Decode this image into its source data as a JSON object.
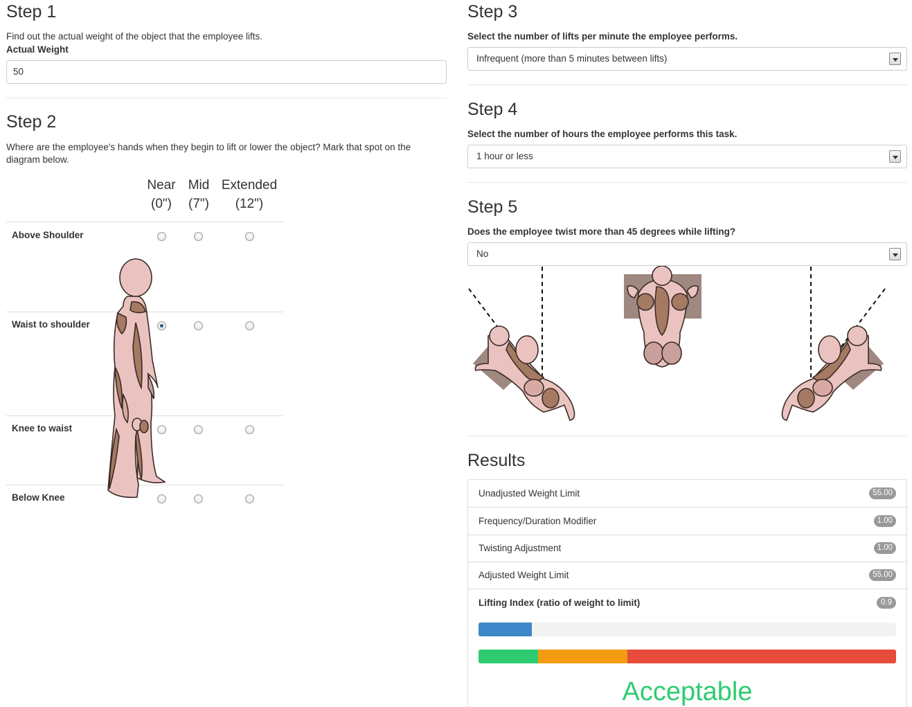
{
  "step1": {
    "title": "Step 1",
    "description": "Find out the actual weight of the object that the employee lifts.",
    "label": "Actual Weight",
    "value": "50"
  },
  "step2": {
    "title": "Step 2",
    "description_line1": "Where are the employee's hands when they begin to lift or lower the object? Mark that spot on the",
    "description_line2": "diagram below.",
    "columns": [
      {
        "name": "Near",
        "distance": "(0\")"
      },
      {
        "name": "Mid",
        "distance": "(7\")"
      },
      {
        "name": "Extended",
        "distance": "(12\")"
      }
    ],
    "rows": [
      "Above Shoulder",
      "Waist to shoulder",
      "Knee to waist",
      "Below Knee"
    ],
    "selected": {
      "row": "Waist to shoulder",
      "column": "Near"
    }
  },
  "step3": {
    "title": "Step 3",
    "label": "Select the number of lifts per minute the employee performs.",
    "selected": "Infrequent (more than 5 minutes between lifts)"
  },
  "step4": {
    "title": "Step 4",
    "label": "Select the number of hours the employee performs this task.",
    "selected": "1 hour or less"
  },
  "step5": {
    "title": "Step 5",
    "label": "Does the employee twist more than 45 degrees while lifting?",
    "selected": "No"
  },
  "results": {
    "title": "Results",
    "items": [
      {
        "label": "Unadjusted Weight Limit",
        "value": "55.00"
      },
      {
        "label": "Frequency/Duration Modifier",
        "value": "1.00"
      },
      {
        "label": "Twisting Adjustment",
        "value": "1.00"
      },
      {
        "label": "Adjusted Weight Limit",
        "value": "55.00"
      }
    ],
    "index_label": "Lifting Index (ratio of weight to limit)",
    "index_value": "0.9",
    "index_bar_fraction": 0.128,
    "scale_segments": [
      {
        "color": "#2ecc71",
        "fraction": 0.143
      },
      {
        "color": "#f39c12",
        "fraction": 0.214
      },
      {
        "color": "#e74c3c",
        "fraction": 0.643
      }
    ],
    "verdict": "Acceptable",
    "verdict_color": "#2ecc71"
  },
  "colors": {
    "skin_light": "#eac3c0",
    "skin_dark": "#a57a62",
    "box": "#9e8880",
    "accent_blue": "#3d87c9"
  }
}
